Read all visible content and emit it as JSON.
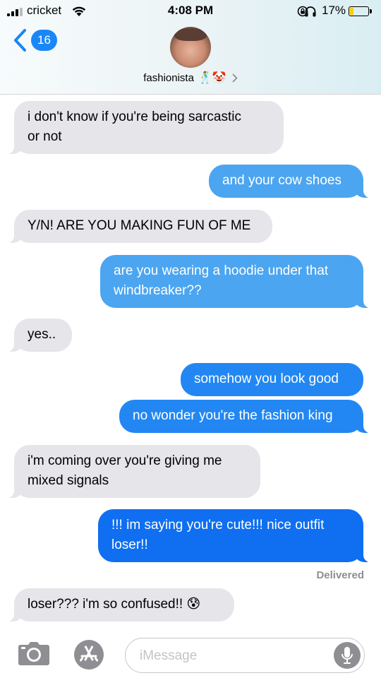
{
  "status_bar": {
    "carrier": "cricket",
    "time": "4:08 PM",
    "battery_percent": "17%",
    "battery_level": 0.17
  },
  "header": {
    "back_count": "16",
    "contact_name": "fashionista",
    "contact_emojis": "🕺🤡",
    "icons": [
      "back-chevron-icon",
      "person-avatar",
      "chevron-right-icon"
    ]
  },
  "messages": [
    {
      "from": "them",
      "lines": [
        "i don't know if you're being sarcastic",
        "or not"
      ]
    },
    {
      "from": "me",
      "lines": [
        "and your cow shoes"
      ]
    },
    {
      "from": "them",
      "lines": [
        "Y/N! ARE YOU MAKING FUN OF ME"
      ]
    },
    {
      "from": "me",
      "lines": [
        "are you wearing a hoodie under that",
        "windbreaker??"
      ]
    },
    {
      "from": "them",
      "lines": [
        "yes.."
      ]
    },
    {
      "from": "me",
      "lines": [
        "somehow you look good"
      ]
    },
    {
      "from": "me",
      "lines": [
        "no wonder you're the fashion king"
      ]
    },
    {
      "from": "them",
      "lines": [
        "i'm coming over you're giving me",
        "mixed signals"
      ]
    },
    {
      "from": "me",
      "lines": [
        "!!! im saying you're cute!!! nice outfit",
        "loser!!"
      ]
    },
    {
      "from": "them",
      "lines": [
        "loser??? i'm so confused!! 😰"
      ]
    }
  ],
  "delivered_label": "Delivered",
  "input_bar": {
    "placeholder": "iMessage",
    "icons": [
      "camera-icon",
      "app-store-icon",
      "microphone-icon"
    ]
  },
  "colors": {
    "incoming_bubble": "#e5e5ea",
    "outgoing_bubble": "#1987f7",
    "badge": "#1987f7"
  }
}
